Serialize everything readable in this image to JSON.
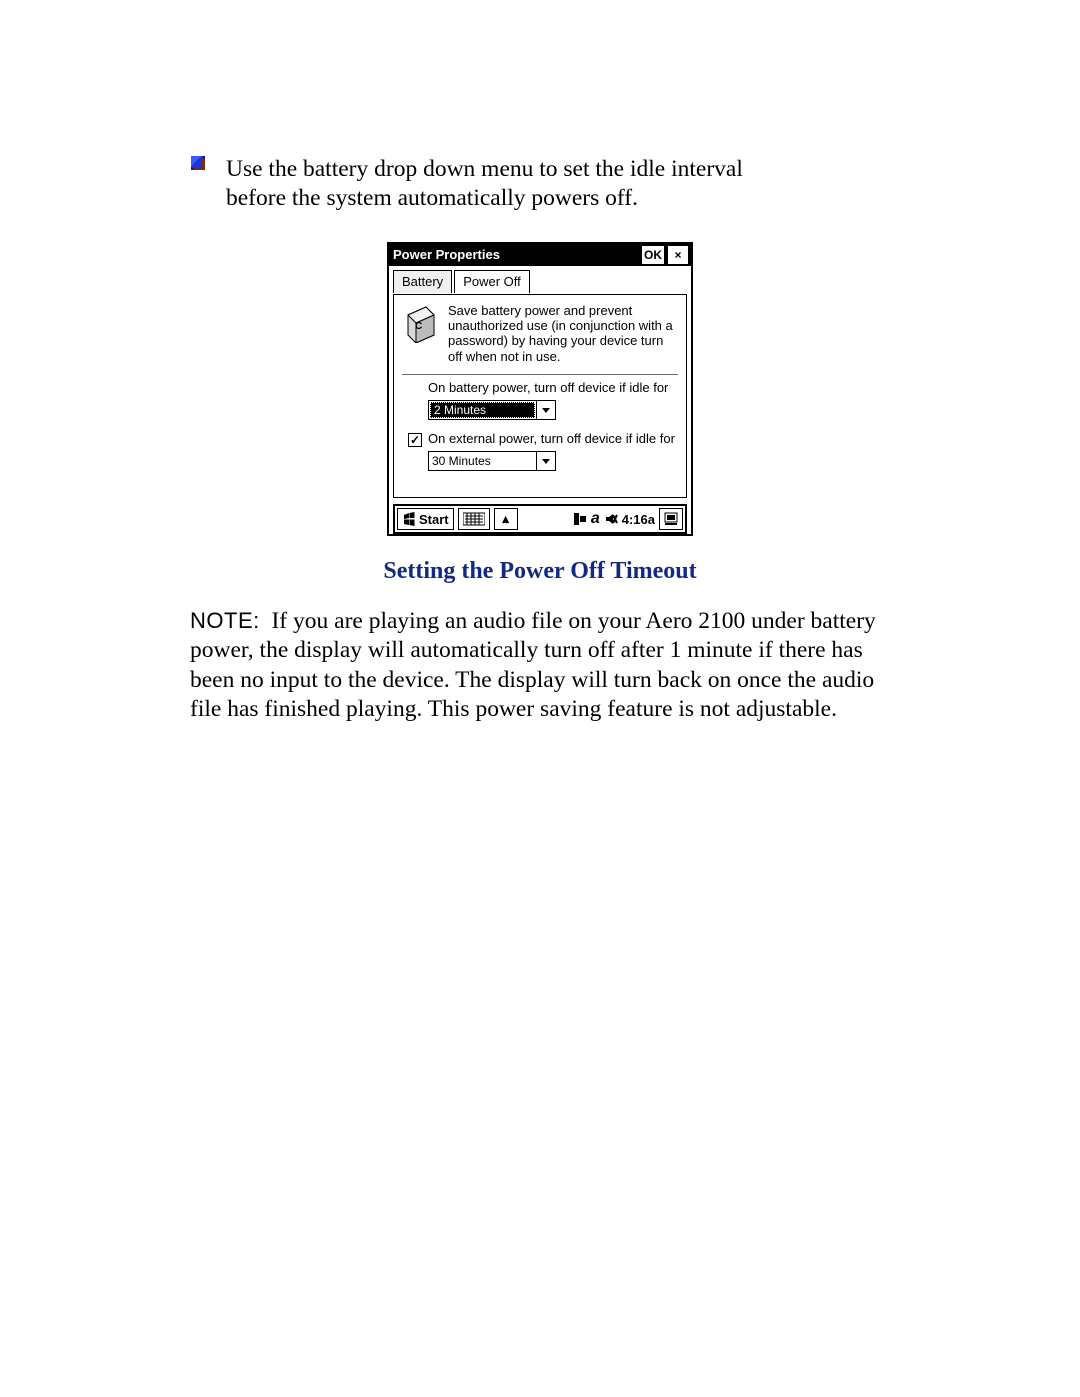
{
  "bullet": {
    "text": "Use the battery drop down menu to set the idle interval before the system automatically powers off."
  },
  "dialog": {
    "title": "Power Properties",
    "ok_label": "OK",
    "close_label": "×",
    "tabs": {
      "battery": "Battery",
      "power_off": "Power Off"
    },
    "description": "Save battery power and prevent unauthorized use (in conjunction with a password) by having your device turn  off when not in use.",
    "battery_setting": {
      "label": "On battery power, turn off device if idle for",
      "value": "2 Minutes"
    },
    "external_setting": {
      "checked_glyph": "✓",
      "label": "On external power, turn off device if idle for",
      "value": "30 Minutes"
    }
  },
  "taskbar": {
    "start_label": "Start",
    "up_glyph": "▴",
    "time": "4:16a"
  },
  "caption": "Setting the Power Off Timeout",
  "note": {
    "label": "NOTE:",
    "text": "If you are playing an audio file on your Aero 2100 under battery power, the display will automatically turn off after 1 minute if there has been no input to the device. The display will turn back on once the audio file has finished playing. This power saving feature is not adjustable."
  }
}
